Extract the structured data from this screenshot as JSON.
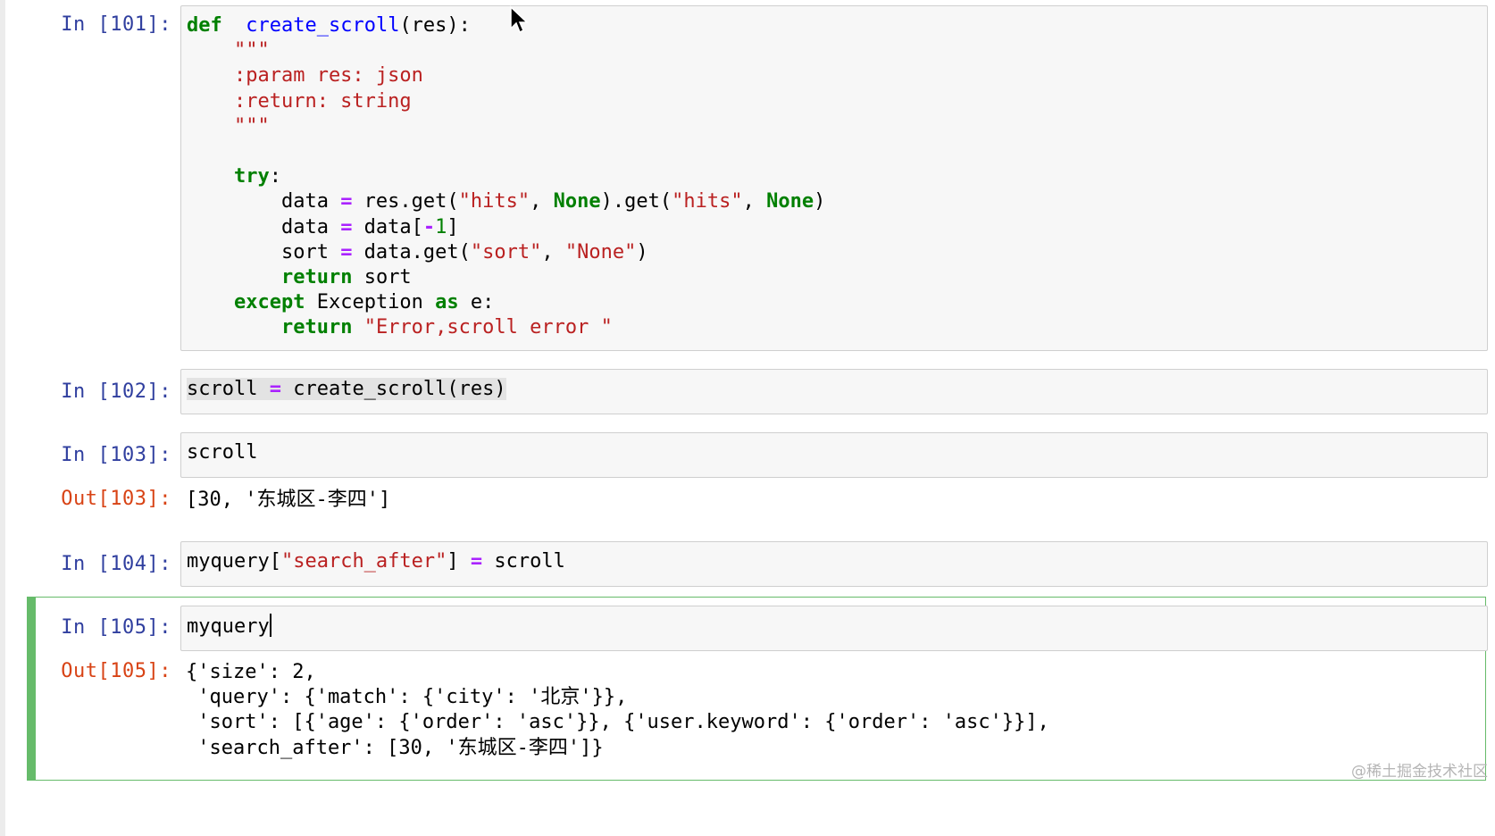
{
  "cells": [
    {
      "in_prompt": "In [101]:",
      "code_lines": [
        [
          [
            "kw",
            "def"
          ],
          [
            "",
            "  "
          ],
          [
            "fn",
            "create_scroll"
          ],
          [
            "",
            "(res):"
          ]
        ],
        [
          [
            "str",
            "    \"\"\""
          ]
        ],
        [
          [
            "str",
            "    :param res: json"
          ]
        ],
        [
          [
            "str",
            "    :return: string"
          ]
        ],
        [
          [
            "str",
            "    \"\"\""
          ]
        ],
        [
          [
            "",
            ""
          ]
        ],
        [
          [
            "",
            "    "
          ],
          [
            "kw",
            "try"
          ],
          [
            "",
            ":"
          ]
        ],
        [
          [
            "",
            "        data "
          ],
          [
            "op",
            "="
          ],
          [
            "",
            " res.get("
          ],
          [
            "str",
            "\"hits\""
          ],
          [
            "",
            ", "
          ],
          [
            "kw",
            "None"
          ],
          [
            "",
            ").get("
          ],
          [
            "str",
            "\"hits\""
          ],
          [
            "",
            ", "
          ],
          [
            "kw",
            "None"
          ],
          [
            "",
            ")"
          ]
        ],
        [
          [
            "",
            "        data "
          ],
          [
            "op",
            "="
          ],
          [
            "",
            " data["
          ],
          [
            "op",
            "-"
          ],
          [
            "num",
            "1"
          ],
          [
            "",
            "]"
          ]
        ],
        [
          [
            "",
            "        sort "
          ],
          [
            "op",
            "="
          ],
          [
            "",
            " data.get("
          ],
          [
            "str",
            "\"sort\""
          ],
          [
            "",
            ", "
          ],
          [
            "str",
            "\"None\""
          ],
          [
            "",
            ")"
          ]
        ],
        [
          [
            "",
            "        "
          ],
          [
            "kw",
            "return"
          ],
          [
            "",
            " sort"
          ]
        ],
        [
          [
            "",
            "    "
          ],
          [
            "kw",
            "except"
          ],
          [
            "",
            " Exception "
          ],
          [
            "kw",
            "as"
          ],
          [
            "",
            " e:"
          ]
        ],
        [
          [
            "",
            "        "
          ],
          [
            "kw",
            "return"
          ],
          [
            "",
            " "
          ],
          [
            "str",
            "\"Error,scroll error \""
          ]
        ]
      ]
    },
    {
      "in_prompt": "In [102]:",
      "code_lines": [
        [
          [
            "",
            "scroll "
          ],
          [
            "op",
            "="
          ],
          [
            "",
            " create_scroll(res)"
          ]
        ]
      ]
    },
    {
      "in_prompt": "In [103]:",
      "code_lines": [
        [
          [
            "",
            "scroll"
          ]
        ]
      ],
      "out_prompt": "Out[103]:",
      "output": "[30, '东城区-李四']"
    },
    {
      "in_prompt": "In [104]:",
      "code_lines": [
        [
          [
            "",
            "myquery["
          ],
          [
            "str",
            "\"search_after\""
          ],
          [
            "",
            "] "
          ],
          [
            "op",
            "="
          ],
          [
            "",
            " scroll"
          ]
        ]
      ]
    },
    {
      "in_prompt": "In [105]:",
      "code_lines": [
        [
          [
            "",
            "myquery"
          ]
        ]
      ],
      "out_prompt": "Out[105]:",
      "output": "{'size': 2,\n 'query': {'match': {'city': '北京'}},\n 'sort': [{'age': {'order': 'asc'}}, {'user.keyword': {'order': 'asc'}}],\n 'search_after': [30, '东城区-李四']}"
    }
  ],
  "watermark": "@稀土掘金技术社区",
  "icons": {
    "pointer": "mouse-pointer-icon"
  },
  "colors": {
    "selected_cell": "#66bb6a",
    "prompt_in": "#303f9f",
    "prompt_out": "#d84315"
  }
}
